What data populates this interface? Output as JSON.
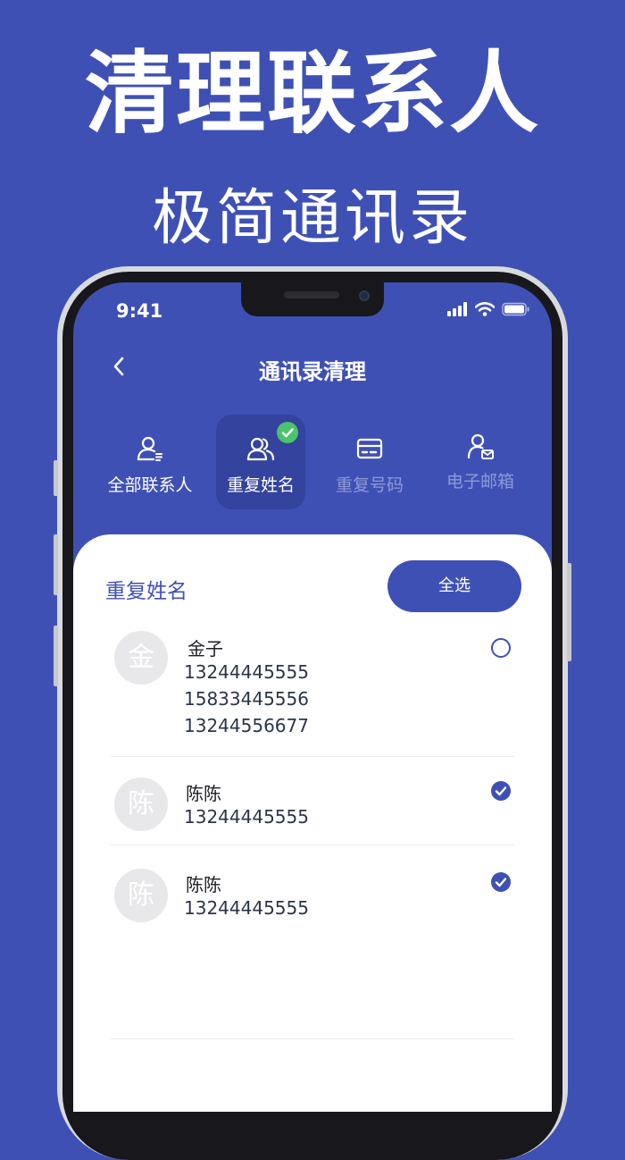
{
  "promo": {
    "headline": "清理联系人",
    "subhead": "极简通讯录"
  },
  "status_bar": {
    "time": "9:41",
    "icons": [
      "signal-icon",
      "wifi-icon",
      "battery-icon"
    ]
  },
  "nav": {
    "back_icon": "chevron-left-icon",
    "title": "通讯录清理"
  },
  "tabs": [
    {
      "label": "全部联系人",
      "icon": "contacts-icon",
      "state": "normal"
    },
    {
      "label": "重复姓名",
      "icon": "two-people-icon",
      "state": "selected"
    },
    {
      "label": "重复号码",
      "icon": "card-icon",
      "state": "dimmed"
    },
    {
      "label": "电子邮箱",
      "icon": "person-mail-icon",
      "state": "dimmed"
    }
  ],
  "list": {
    "section_title": "重复姓名",
    "select_all_label": "全选",
    "contacts": [
      {
        "avatar": "金",
        "name": "金子",
        "phones": [
          "13244445555",
          "15833445556",
          "13244556677"
        ],
        "checked": false
      },
      {
        "avatar": "陈",
        "name": "陈陈",
        "phones": [
          "13244445555"
        ],
        "checked": true
      },
      {
        "avatar": "陈",
        "name": "陈陈",
        "phones": [
          "13244445555"
        ],
        "checked": true
      }
    ]
  },
  "colors": {
    "brand": "#3f50b5",
    "badge": "#4bc36a",
    "avatar_bg": "#e8e8ea"
  }
}
